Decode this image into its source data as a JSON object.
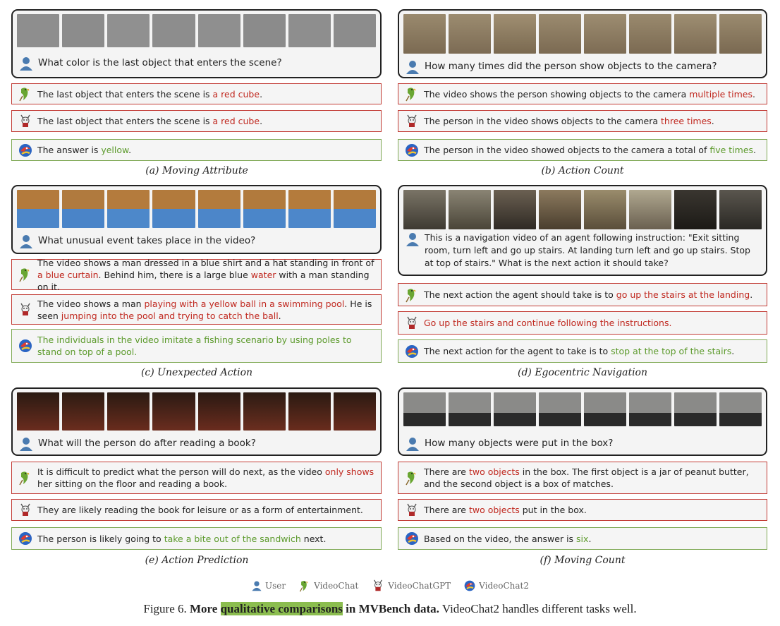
{
  "panels": [
    {
      "question": "What color is the last object that enters the scene?",
      "answers": [
        {
          "pre": "The last object that enters the scene is ",
          "hl": "a red cube",
          "post": "."
        },
        {
          "pre": "The last object that enters the scene is ",
          "hl": "a red cube",
          "post": "."
        },
        {
          "pre": "The answer is ",
          "hl": "yellow",
          "post": "."
        }
      ],
      "caption": "(a) Moving Attribute"
    },
    {
      "question": "How many times did the person show objects to the camera?",
      "answers": [
        {
          "pre": "The video shows the person showing objects to the camera ",
          "hl": "multiple times",
          "post": "."
        },
        {
          "pre": "The person in the video shows objects to the camera ",
          "hl": "three times",
          "post": "."
        },
        {
          "pre": "The person in the video showed objects to the camera a total of ",
          "hl": "five times",
          "post": "."
        }
      ],
      "caption": "(b) Action Count"
    },
    {
      "question": "What unusual event takes place in the video?",
      "answers": [
        {
          "pre": "The video shows a man dressed in a blue shirt and a hat standing in front of ",
          "hl": "a blue curtain",
          "mid": ". Behind him, there is a large blue ",
          "hl2": "water",
          "post": " with a man standing on it."
        },
        {
          "pre": "The video shows a man ",
          "hl": "playing with a yellow ball in a swimming pool",
          "mid": ". He is seen ",
          "hl2": "jumping into the pool and trying to catch the ball",
          "post": "."
        },
        {
          "pre": "",
          "hl": "The individuals in the video imitate a fishing scenario by using poles to stand on top of a pool",
          "post": "."
        }
      ],
      "caption": "(c) Unexpected Action"
    },
    {
      "question": "This is a navigation video of an agent following instruction: \"Exit sitting room, turn left and go up stairs. At landing turn left and go up stairs. Stop at top of stairs.\" What is the next action it should take?",
      "answers": [
        {
          "pre": "The next action the agent should take is to ",
          "hl": "go up the stairs at the landing",
          "post": "."
        },
        {
          "pre": "",
          "hl": "Go up the stairs and continue following the instructions",
          "post": "."
        },
        {
          "pre": "The next action for the agent to take is to ",
          "hl": "stop at the top of the stairs",
          "post": "."
        }
      ],
      "caption": "(d) Egocentric Navigation"
    },
    {
      "question": "What will the person do after reading a book?",
      "answers": [
        {
          "pre": "It is difficult to predict what the person will do next, as the video ",
          "hl": "only shows",
          "post": " her sitting on the floor and reading a book."
        },
        {
          "pre": "They are likely reading the book for leisure or as a form of entertainment.",
          "hl": "",
          "post": ""
        },
        {
          "pre": "The person is likely going to ",
          "hl": "take a bite out of the sandwich",
          "post": " next."
        }
      ],
      "caption": "(e) Action Prediction"
    },
    {
      "question": "How many objects were put in the box?",
      "answers": [
        {
          "pre": "There are ",
          "hl": "two objects",
          "post": " in the box. The first object is a jar of peanut butter, and the second object is a box of matches."
        },
        {
          "pre": "There are ",
          "hl": "two objects",
          "post": " put in the box."
        },
        {
          "pre": "Based on the video, the answer is ",
          "hl": "six",
          "post": "."
        }
      ],
      "caption": "(f) Moving Count"
    }
  ],
  "legend": [
    "User",
    "VideoChat",
    "VideoChatGPT",
    "VideoChat2"
  ],
  "figure": {
    "label": "Figure 6.",
    "bold_pre": "More ",
    "bold_mark": "qualitative comparisons",
    "bold_post": " in MVBench data.",
    "rest": " VideoChat2 handles different tasks well."
  },
  "colors": {
    "wrong": "#c0281f",
    "right": "#5c9a2c",
    "red_border": "#c23b35",
    "green_border": "#7fa955"
  }
}
